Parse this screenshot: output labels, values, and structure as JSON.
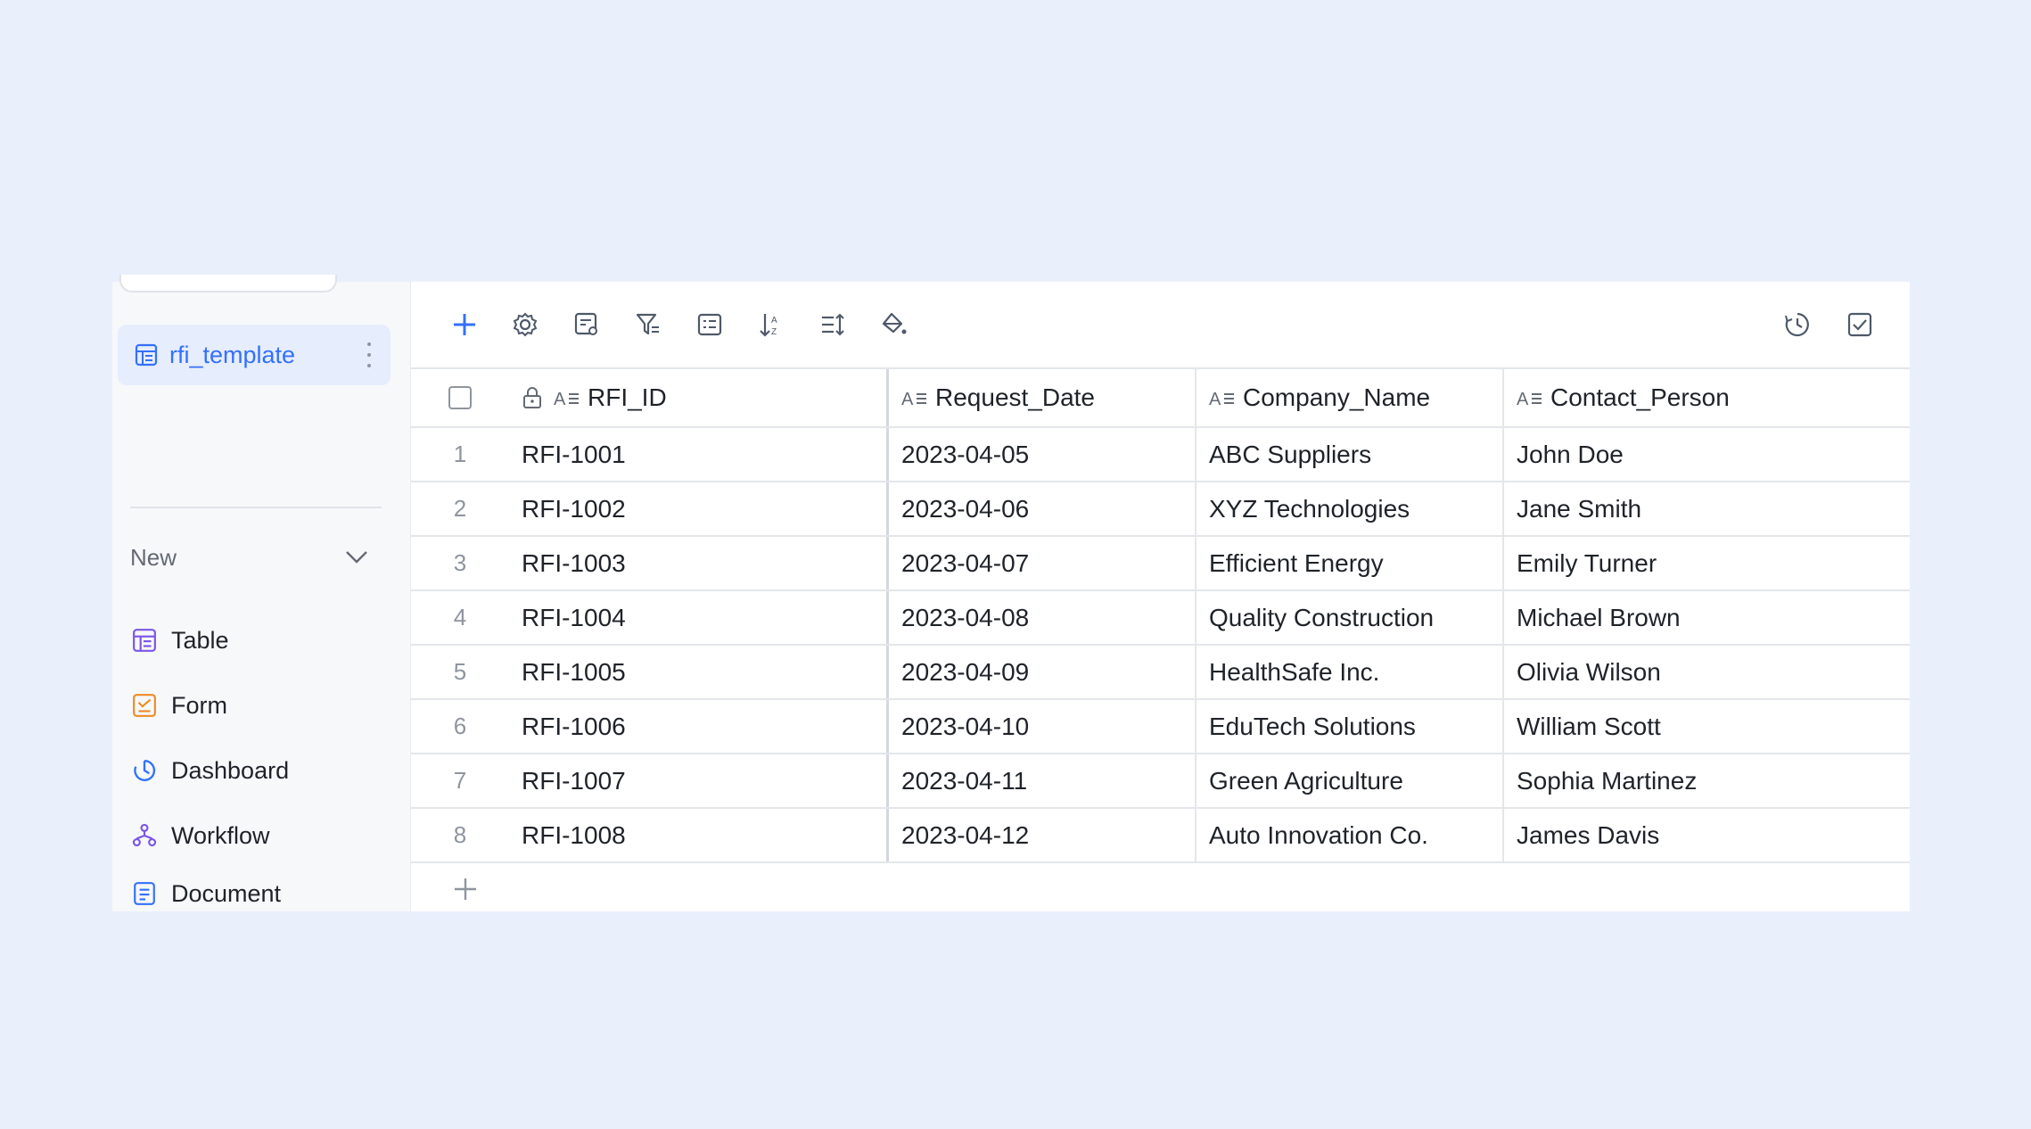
{
  "sidebar": {
    "active_table": "rfi_template",
    "new_label": "New",
    "create_items": [
      {
        "label": "Table",
        "icon": "table-icon"
      },
      {
        "label": "Form",
        "icon": "form-icon"
      },
      {
        "label": "Dashboard",
        "icon": "dashboard-icon"
      },
      {
        "label": "Workflow",
        "icon": "workflow-icon"
      },
      {
        "label": "Document",
        "icon": "document-icon"
      }
    ]
  },
  "toolbar": {
    "icons": [
      "add-icon",
      "settings-icon",
      "field-config-icon",
      "filter-icon",
      "group-icon",
      "sort-icon",
      "row-height-icon",
      "fill-color-icon",
      "history-icon",
      "checklist-icon"
    ]
  },
  "table": {
    "columns": [
      "RFI_ID",
      "Request_Date",
      "Company_Name",
      "Contact_Person"
    ],
    "rows": [
      {
        "n": "1",
        "id": "RFI-1001",
        "date": "2023-04-05",
        "company": "ABC Suppliers",
        "contact": "John Doe"
      },
      {
        "n": "2",
        "id": "RFI-1002",
        "date": "2023-04-06",
        "company": "XYZ Technologies",
        "contact": "Jane Smith"
      },
      {
        "n": "3",
        "id": "RFI-1003",
        "date": "2023-04-07",
        "company": "Efficient Energy",
        "contact": "Emily Turner"
      },
      {
        "n": "4",
        "id": "RFI-1004",
        "date": "2023-04-08",
        "company": "Quality Construction",
        "contact": "Michael Brown"
      },
      {
        "n": "5",
        "id": "RFI-1005",
        "date": "2023-04-09",
        "company": "HealthSafe Inc.",
        "contact": "Olivia Wilson"
      },
      {
        "n": "6",
        "id": "RFI-1006",
        "date": "2023-04-10",
        "company": "EduTech Solutions",
        "contact": "William Scott"
      },
      {
        "n": "7",
        "id": "RFI-1007",
        "date": "2023-04-11",
        "company": "Green Agriculture",
        "contact": "Sophia Martinez"
      },
      {
        "n": "8",
        "id": "RFI-1008",
        "date": "2023-04-12",
        "company": "Auto Innovation Co.",
        "contact": "James Davis"
      }
    ]
  },
  "colors": {
    "accent": "#3370ff",
    "background": "#e9effb",
    "form_icon": "#f08a24",
    "workflow_icon": "#7b55e8"
  }
}
